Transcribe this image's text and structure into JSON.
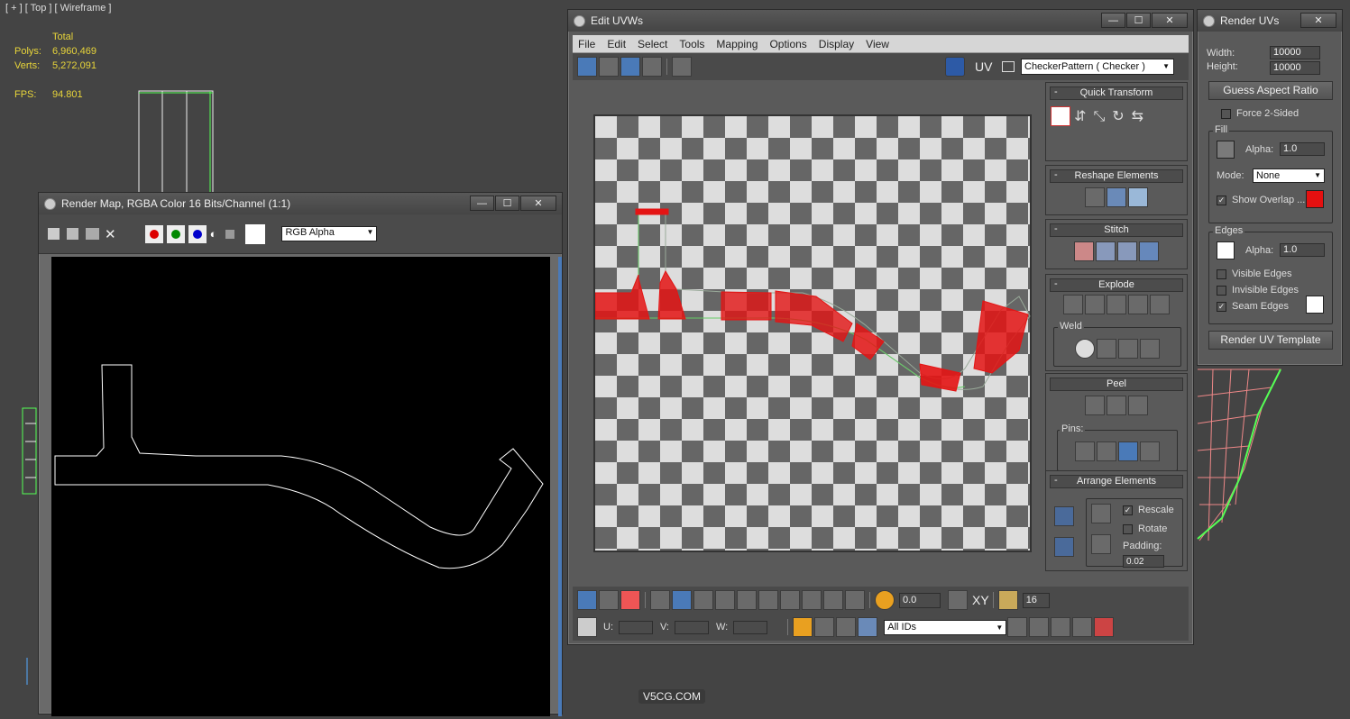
{
  "viewport": {
    "label": "[ + ] [ Top ] [ Wireframe ]",
    "stats": {
      "total_label": "Total",
      "polys_label": "Polys:",
      "polys": "6,960,469",
      "verts_label": "Verts:",
      "verts": "5,272,091",
      "fps_label": "FPS:",
      "fps": "94.801"
    }
  },
  "render_map": {
    "title": "Render Map, RGBA Color 16 Bits/Channel (1:1)",
    "channel": "RGB Alpha"
  },
  "edit_uvw": {
    "title": "Edit UVWs",
    "menu": [
      "File",
      "Edit",
      "Select",
      "Tools",
      "Mapping",
      "Options",
      "Display",
      "View"
    ],
    "uv_label": "UV",
    "map_select": "CheckerPattern  ( Checker )",
    "panels": {
      "quick_transform": "Quick Transform",
      "reshape": "Reshape Elements",
      "stitch": "Stitch",
      "explode": "Explode",
      "weld": "Weld",
      "peel": "Peel",
      "pins": "Pins:",
      "arrange": "Arrange Elements",
      "rescale": "Rescale",
      "rotate": "Rotate",
      "padding_label": "Padding:",
      "padding": "0.02"
    },
    "bottom": {
      "soft_value": "0.0",
      "xy": "XY",
      "grid_value": "16",
      "u": "U:",
      "v": "V:",
      "w": "W:",
      "ids": "All IDs"
    }
  },
  "render_uvs": {
    "title": "Render UVs",
    "width_label": "Width:",
    "width": "10000",
    "height_label": "Height:",
    "height": "10000",
    "guess": "Guess Aspect Ratio",
    "force": "Force 2-Sided",
    "fill": "Fill",
    "alpha_label": "Alpha:",
    "fill_alpha": "1.0",
    "mode_label": "Mode:",
    "mode": "None",
    "show_overlap": "Show Overlap ...",
    "edges": "Edges",
    "edges_alpha": "1.0",
    "visible": "Visible Edges",
    "invisible": "Invisible Edges",
    "seam": "Seam Edges",
    "render_btn": "Render UV Template",
    "colors": {
      "overlap": "#e51010",
      "fill": "#7a7a7a",
      "edge": "#ffffff",
      "seam": "#ffffff"
    }
  },
  "watermark": "V5CG.COM"
}
